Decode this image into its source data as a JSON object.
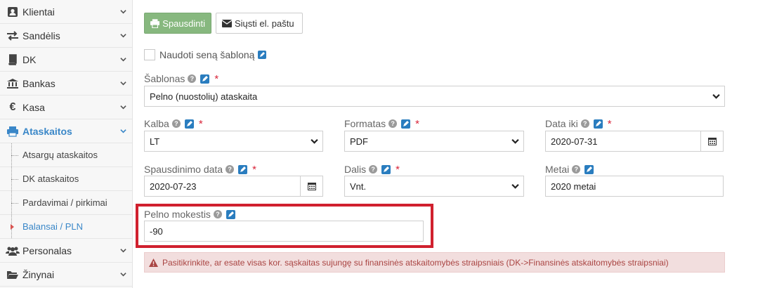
{
  "sidebar": {
    "items": [
      {
        "label": "Klientai",
        "icon": "user-card-icon"
      },
      {
        "label": "Sandėlis",
        "icon": "exchange-icon"
      },
      {
        "label": "DK",
        "icon": "book-icon"
      },
      {
        "label": "Bankas",
        "icon": "bank-icon"
      },
      {
        "label": "Kasa",
        "icon": "euro-icon"
      },
      {
        "label": "Ataskaitos",
        "icon": "print-icon"
      }
    ],
    "subitems": [
      {
        "label": "Atsargų ataskaitos"
      },
      {
        "label": "DK ataskaitos"
      },
      {
        "label": "Pardavimai / pirkimai"
      },
      {
        "label": "Balansai / PLN"
      }
    ],
    "after_items": [
      {
        "label": "Personalas",
        "icon": "users-icon"
      },
      {
        "label": "Žinynai",
        "icon": "folder-open-icon"
      }
    ]
  },
  "toolbar": {
    "print_label": "Spausdinti",
    "email_label": "Siųsti el. paštu"
  },
  "form": {
    "old_template_label": "Naudoti seną šabloną",
    "template_label": "Šablonas",
    "template_value": "Pelno (nuostolių) ataskaita",
    "language_label": "Kalba",
    "language_value": "LT",
    "format_label": "Formatas",
    "format_value": "PDF",
    "date_to_label": "Data iki",
    "date_to_value": "2020-07-31",
    "print_date_label": "Spausdinimo data",
    "print_date_value": "2020-07-23",
    "part_label": "Dalis",
    "part_value": "Vnt.",
    "year_label": "Metai",
    "year_value": "2020 metai",
    "tax_label": "Pelno mokestis",
    "tax_value": "-90",
    "required_mark": "*",
    "help_mark": "?"
  },
  "alert": {
    "text": "Pasitikrinkite, ar esate visas kor. sąskaitas sujungę su finansinės atskaitomybės straipsniais (DK->Finansinės atskaitomybės straipsniai)"
  },
  "colors": {
    "accent": "#3a87c8",
    "print_button": "#87b87f",
    "highlight": "#d0202e",
    "alert_bg": "#f2dede",
    "alert_text": "#a94442"
  }
}
